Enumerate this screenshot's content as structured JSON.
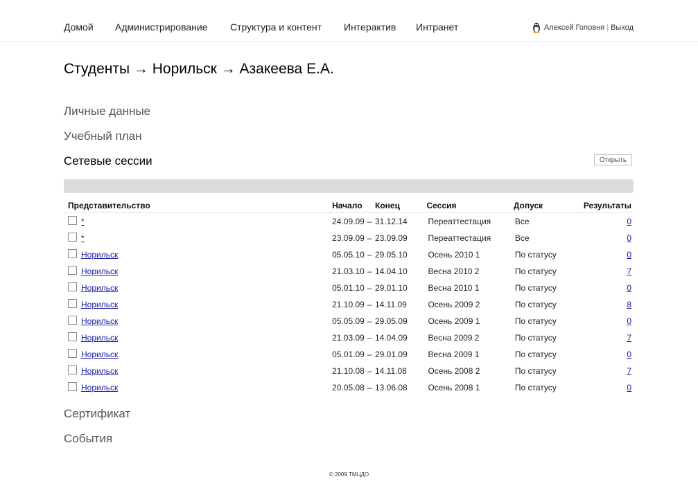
{
  "nav": {
    "items": [
      {
        "label": "Домой"
      },
      {
        "label": "Администрирование"
      },
      {
        "label": "Структура и контент"
      },
      {
        "label": "Интерактив"
      },
      {
        "label": "Интранет"
      }
    ]
  },
  "user": {
    "name": "Алексей Головня",
    "separator": "|",
    "logout": "Выход",
    "icon": "penguin-icon"
  },
  "page_title": "Студенты → Норильск → Азакеева Е.А.",
  "sections": {
    "personal": "Личные данные",
    "plan": "Учебный план",
    "sessions": "Сетевые сессии",
    "certificate": "Сертификат",
    "events": "События"
  },
  "open_button": "Открыть",
  "table": {
    "headers": {
      "rep": "Представительство",
      "start": "Начало",
      "end": "Конец",
      "session": "Сессия",
      "access": "Допуск",
      "results": "Результаты"
    },
    "rows": [
      {
        "rep": "*",
        "start": "24.09.09",
        "end": "31.12.14",
        "session": "Переаттестация",
        "access": "Все",
        "results": "0"
      },
      {
        "rep": "*",
        "start": "23.09.09",
        "end": "23.09.09",
        "session": "Переаттестация",
        "access": "Все",
        "results": "0"
      },
      {
        "rep": "Норильск",
        "start": "05.05.10",
        "end": "29.05.10",
        "session": "Осень 2010 1",
        "access": "По статусу",
        "results": "0"
      },
      {
        "rep": "Норильск",
        "start": "21.03.10",
        "end": "14.04.10",
        "session": "Весна 2010 2",
        "access": "По статусу",
        "results": "7"
      },
      {
        "rep": "Норильск",
        "start": "05.01.10",
        "end": "29.01.10",
        "session": "Весна 2010 1",
        "access": "По статусу",
        "results": "0"
      },
      {
        "rep": "Норильск",
        "start": "21.10.09",
        "end": "14.11.09",
        "session": "Осень 2009 2",
        "access": "По статусу",
        "results": "8"
      },
      {
        "rep": "Норильск",
        "start": "05.05.09",
        "end": "29.05.09",
        "session": "Осень 2009 1",
        "access": "По статусу",
        "results": "0"
      },
      {
        "rep": "Норильск",
        "start": "21.03.09",
        "end": "14.04.09",
        "session": "Весна 2009 2",
        "access": "По статусу",
        "results": "7"
      },
      {
        "rep": "Норильск",
        "start": "05.01.09",
        "end": "29.01.09",
        "session": "Весна 2009 1",
        "access": "По статусу",
        "results": "0"
      },
      {
        "rep": "Норильск",
        "start": "21.10.08",
        "end": "14.11.08",
        "session": "Осень 2008 2",
        "access": "По статусу",
        "results": "7"
      },
      {
        "rep": "Норильск",
        "start": "20.05.08",
        "end": "13.06.08",
        "session": "Осень 2008 1",
        "access": "По статусу",
        "results": "0"
      }
    ],
    "date_separator": "–"
  },
  "footer": "© 2009 ТМЦДО"
}
